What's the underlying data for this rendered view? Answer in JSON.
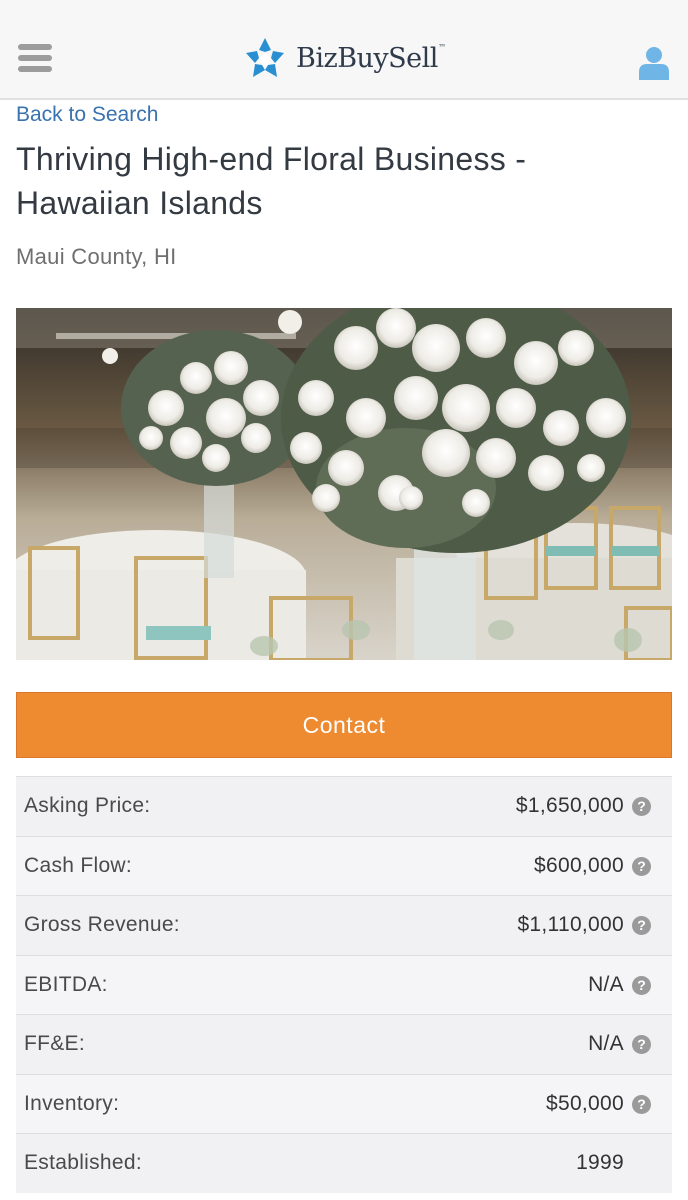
{
  "header": {
    "brand": "BizBuySell",
    "brand_tm": "™",
    "brand_color": "#2a8fd0"
  },
  "nav": {
    "back_label": "Back to Search"
  },
  "listing": {
    "title": "Thriving High-end Floral Business - Hawaiian Islands",
    "location": "Maui County, HI",
    "photo_description_icon": "floral-centerpiece-photo"
  },
  "contact_button": {
    "label": "Contact",
    "color": "#ee8a30"
  },
  "financials": [
    {
      "label": "Asking Price:",
      "value": "$1,650,000",
      "has_help": true
    },
    {
      "label": "Cash Flow:",
      "value": "$600,000",
      "has_help": true
    },
    {
      "label": "Gross Revenue:",
      "value": "$1,110,000",
      "has_help": true
    },
    {
      "label": "EBITDA:",
      "value": "N/A",
      "has_help": true
    },
    {
      "label": "FF&E:",
      "value": "N/A",
      "has_help": true
    },
    {
      "label": "Inventory:",
      "value": "$50,000",
      "has_help": true
    },
    {
      "label": "Established:",
      "value": "1999",
      "has_help": false
    }
  ],
  "help_icon_glyph": "?"
}
